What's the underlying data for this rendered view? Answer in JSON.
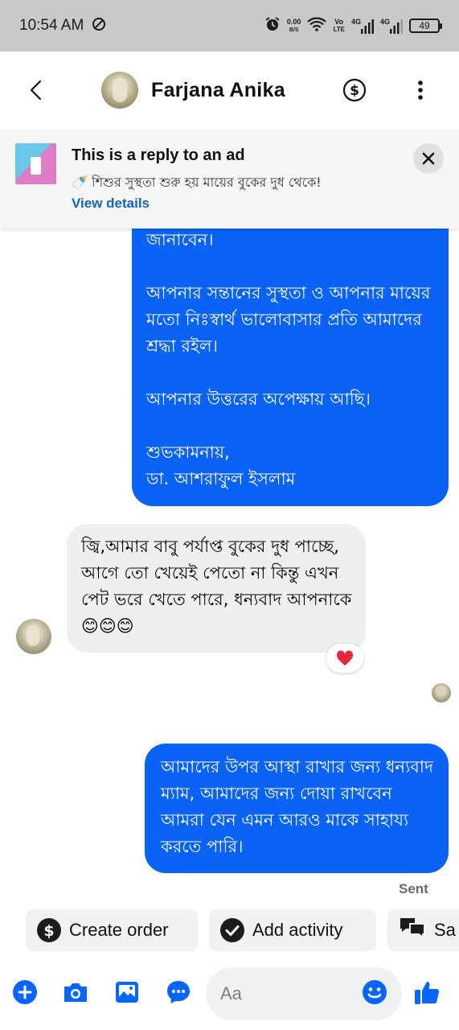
{
  "status_bar": {
    "time": "10:54 AM",
    "speed_value": "0.00",
    "speed_unit": "B/S",
    "volte_top": "Vo",
    "volte_bottom": "LTE",
    "net1": "4G",
    "net2": "4G",
    "battery": "49"
  },
  "header": {
    "contact_name": "Farjana Anika"
  },
  "ad_banner": {
    "title": "This is a reply to an ad",
    "description": "🍼 শিশুর সুস্থতা শুরু হয় মায়ের বুকের দুধ থেকে!",
    "link": "View details"
  },
  "messages": {
    "sent_1": {
      "p1": "জানাবেন।",
      "p2": "আপনার সন্তানের সুস্থতা ও আপনার মায়ের মতো নিঃস্বার্থ ভালোবাসার প্রতি আমাদের শ্রদ্ধা রইল।",
      "p3": "আপনার উত্তরের অপেক্ষায় আছি।",
      "p4_line1": "শুভকামনায়,",
      "p4_line2": "ডা. আশরাফুল ইসলাম"
    },
    "received_1": {
      "text": "জ্বি,আমার বাবু পর্যাপ্ত বুকের দুধ পাচ্ছে, আগে তো খেয়েই পেতো না কিন্তু এখন পেট ভরে খেতে পারে, ধন্যবাদ আপনাকে 😊😊😊",
      "reaction": "❤️"
    },
    "sent_2": {
      "text": "আমাদের উপর আস্থা রাখার জন্য ধন্যবাদ ম্যাম, আমাদের জন্য দোয়া রাখবেন আমরা যেন এমন আরও মাকে সাহায্য করতে পারি।",
      "status": "Sent"
    }
  },
  "quick_actions": [
    {
      "label": "Create order"
    },
    {
      "label": "Add activity"
    },
    {
      "label": "Sa"
    }
  ],
  "composer": {
    "placeholder": "Aa"
  },
  "colors": {
    "sent_bubble": "#0a63f5",
    "received_bubble": "#eeeff1",
    "accent": "#0866ff"
  }
}
